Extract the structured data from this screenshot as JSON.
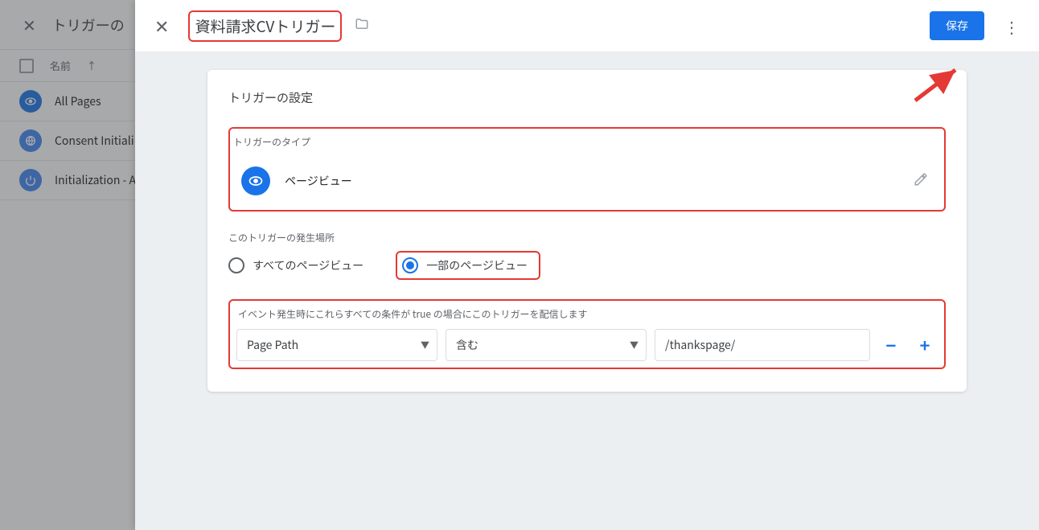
{
  "background": {
    "close": "✕",
    "title": "トリガーの",
    "col_name": "名前",
    "rows": [
      {
        "icon": "eye",
        "label": "All Pages"
      },
      {
        "icon": "globe",
        "label": "Consent Initiali"
      },
      {
        "icon": "power",
        "label": "Initialization - A"
      }
    ]
  },
  "modal": {
    "close": "✕",
    "trigger_name": "資料請求CVトリガー",
    "save": "保存",
    "kebab": "⋮",
    "card_title": "トリガーの設定",
    "type_section": "トリガーのタイプ",
    "type_value": "ページビュー",
    "fires_section": "このトリガーの発生場所",
    "fires_all": "すべてのページビュー",
    "fires_some": "一部のページビュー",
    "cond_desc": "イベント発生時にこれらすべての条件が true の場合にこのトリガーを配信します",
    "cond_var": "Page Path",
    "cond_op": "含む",
    "cond_val": "/thankspage/",
    "minus": "−",
    "plus": "+"
  }
}
